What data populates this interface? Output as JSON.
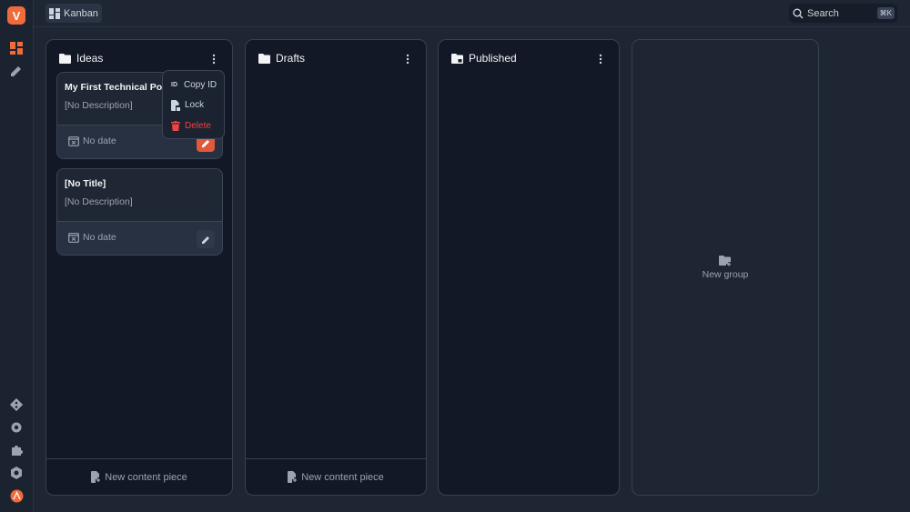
{
  "app": {
    "logo_letter": "V"
  },
  "topbar": {
    "view_label": "Kanban",
    "search_placeholder": "Search",
    "search_shortcut": "⌘K"
  },
  "columns": [
    {
      "title": "Ideas",
      "footer": "New content piece"
    },
    {
      "title": "Drafts",
      "footer": "New content piece"
    },
    {
      "title": "Published",
      "footer": ""
    }
  ],
  "cards": [
    {
      "title": "My First Technical Post",
      "description": "[No Description]",
      "date": "No date"
    },
    {
      "title": "[No Title]",
      "description": "[No Description]",
      "date": "No date"
    }
  ],
  "context_menu": {
    "copy_id": "Copy ID",
    "lock": "Lock",
    "delete": "Delete"
  },
  "new_group": {
    "label": "New group"
  },
  "colors": {
    "accent": "#f06b3b",
    "danger": "#ef4444",
    "background": "#1e2533",
    "column": "#121826"
  }
}
